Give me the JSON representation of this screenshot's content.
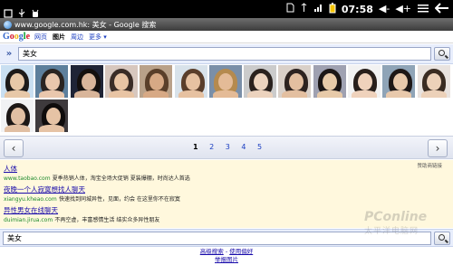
{
  "statusbar": {
    "time": "07:58",
    "left_icons": [
      "square-icon",
      "usb-icon",
      "android-debug-icon"
    ],
    "right_icons": [
      "sd-card-icon",
      "sync-icon",
      "signal-icon",
      "battery-icon"
    ],
    "volume_down": "◀-",
    "volume_up": "◀+",
    "menu_icon": "menu-icon",
    "back_icon": "back-arrow-icon"
  },
  "titlebar": {
    "text": "www.google.com.hk: 美女 - Google 搜索"
  },
  "google_nav": {
    "logo": "Google",
    "tabs": [
      {
        "label": "网页",
        "active": false
      },
      {
        "label": "图片",
        "active": true
      },
      {
        "label": "周边",
        "active": false
      },
      {
        "label": "更多",
        "active": false
      }
    ]
  },
  "search": {
    "collapse_label": "»",
    "query": "美女"
  },
  "images": {
    "count": 15,
    "palettes": [
      [
        "#c9dff1",
        "#e7c8a8",
        "#1d1a19"
      ],
      [
        "#5d7f9c",
        "#e9c7ad",
        "#2a2421"
      ],
      [
        "#1f2436",
        "#d8b59a",
        "#14100e"
      ],
      [
        "#d7c7be",
        "#e8c4a4",
        "#3a2c26"
      ],
      [
        "#b9a189",
        "#d7a985",
        "#5a3f2a"
      ],
      [
        "#d8e2ea",
        "#e6c1a1",
        "#5a3e2b"
      ],
      [
        "#7a8fa8",
        "#e4bb97",
        "#b58a4e"
      ],
      [
        "#cbcbcb",
        "#ecd3be",
        "#2a211d"
      ],
      [
        "#d9d0c8",
        "#e3bfa0",
        "#2d2320"
      ],
      [
        "#9fa1b1",
        "#e7caa9",
        "#1b1616"
      ],
      [
        "#f2f2f2",
        "#efd2bc",
        "#281f1b"
      ],
      [
        "#8fa4b7",
        "#e8c9ac",
        "#1e1817"
      ],
      [
        "#e9e3df",
        "#ecd1b9",
        "#3a2c22"
      ],
      [
        "#f1f2f4",
        "#e1bfa3",
        "#1c1716"
      ],
      [
        "#3e3a3d",
        "#e6c3a5",
        "#0f0c0c"
      ]
    ]
  },
  "pager": {
    "prev": "‹",
    "next": "›",
    "pages": [
      "1",
      "2",
      "3",
      "4",
      "5"
    ],
    "current": "1"
  },
  "ads": {
    "label": "赞助商链接",
    "items": [
      {
        "title": "人体",
        "url": "www.taobao.com",
        "desc": "夏季热销人体，淘宝全场大促销 夏装爆棚，时尚达人首选"
      },
      {
        "title": "夜晚一个人寂寞想找人聊天",
        "url": "xiangyu.kheao.com",
        "desc": "快速找到同城异性，见面，约会 在这里你不在寂寞"
      },
      {
        "title": "异性男女在线聊天",
        "url": "duimian.jirua.com",
        "desc": "不再空虚，丰富感情生活 结实众多异性朋友"
      }
    ]
  },
  "bottom_search": {
    "query": "美女"
  },
  "footer": {
    "advanced": "高级搜索",
    "separator": " - ",
    "prefs": "使用偏好",
    "report": "举报图片"
  },
  "watermark": {
    "brand": "PConline",
    "tagline": "太平洋电脑网"
  },
  "colors": {
    "link": "#1a0dab",
    "ad_url": "#1c8a2c",
    "ad_bg": "#fff8dd",
    "search_bg": "#e8eefc"
  }
}
